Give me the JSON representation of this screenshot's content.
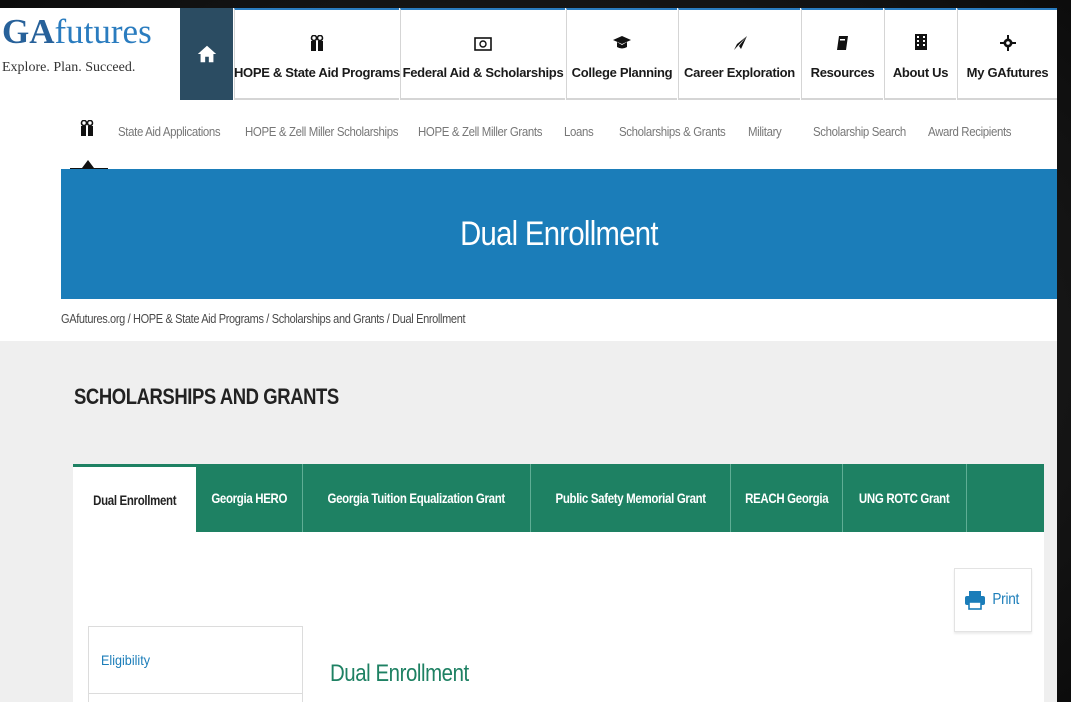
{
  "logo": {
    "main_bold": "GA",
    "main_rest": "futures",
    "tagline": "Explore. Plan. Succeed."
  },
  "topnav": {
    "items": [
      {
        "label": "HOPE & State Aid Programs",
        "icon": "gift-icon"
      },
      {
        "label": "Federal Aid & Scholarships",
        "icon": "money-icon"
      },
      {
        "label": "College Planning",
        "icon": "graduation-cap-icon"
      },
      {
        "label": "Career Exploration",
        "icon": "paper-plane-icon"
      },
      {
        "label": "Resources",
        "icon": "book-icon"
      },
      {
        "label": "About Us",
        "icon": "building-icon"
      },
      {
        "label": "My GAfutures",
        "icon": "gear-icon"
      }
    ]
  },
  "subnav": {
    "items": [
      "State Aid Applications",
      "HOPE & Zell Miller Scholarships",
      "HOPE & Zell Miller Grants",
      "Loans",
      "Scholarships & Grants",
      "Military",
      "Scholarship Search",
      "Award Recipients"
    ]
  },
  "hero": {
    "title": "Dual Enrollment"
  },
  "breadcrumb": "GAfutures.org / HOPE & State Aid Programs / Scholarships and Grants / Dual Enrollment",
  "section": {
    "title": "SCHOLARSHIPS AND GRANTS"
  },
  "tabs": [
    "Dual Enrollment",
    "Georgia HERO",
    "Georgia Tuition Equalization Grant",
    "Public Safety Memorial Grant",
    "REACH Georgia",
    "UNG ROTC Grant"
  ],
  "print": {
    "label": "Print"
  },
  "sidenav": {
    "items": [
      "Eligibility",
      ""
    ]
  },
  "content": {
    "heading": "Dual Enrollment"
  },
  "colors": {
    "brand_blue": "#1b7db9",
    "nav_dark": "#2b4c62",
    "tab_green": "#1e8163"
  }
}
